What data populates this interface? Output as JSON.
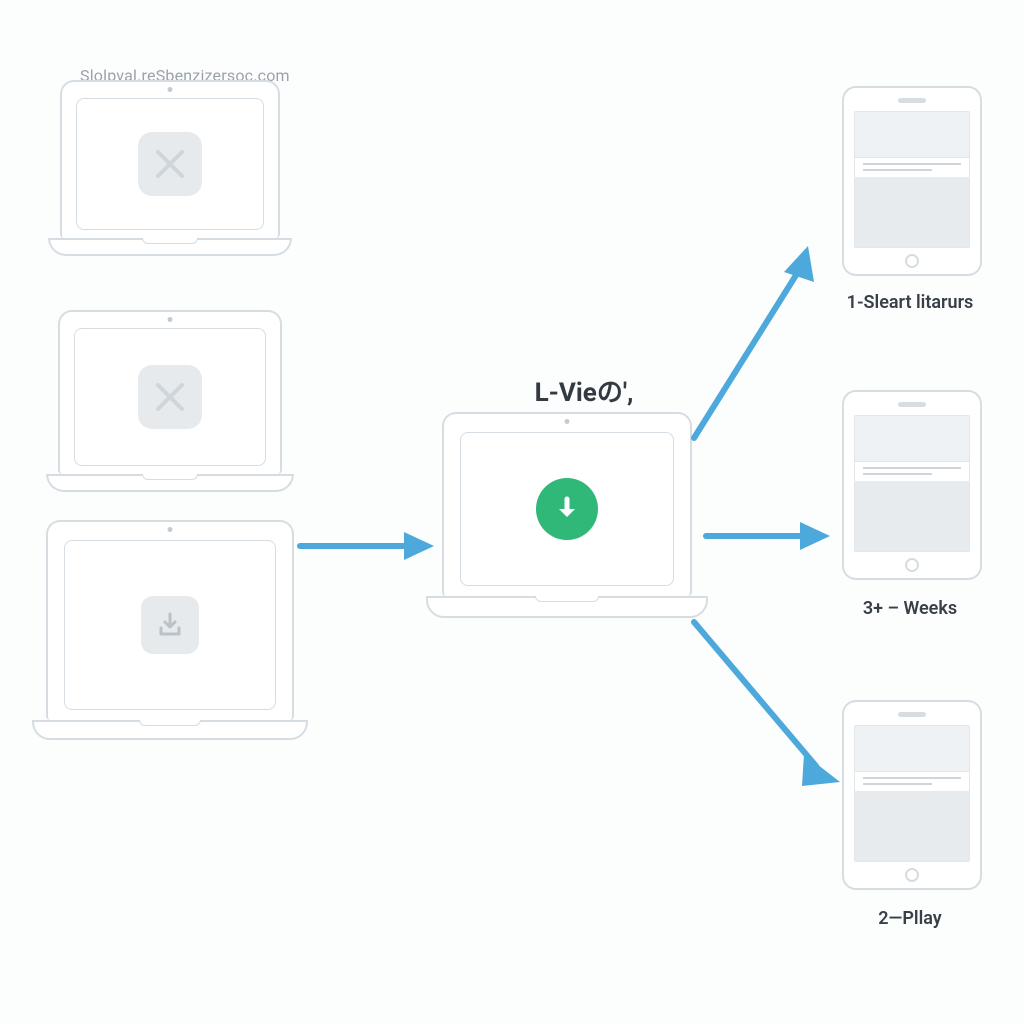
{
  "watermark": "Slolpval.reSbenzizersoc.com",
  "left_devices": {
    "device_1": {
      "icon": "x-icon"
    },
    "device_2": {
      "icon": "x-icon"
    },
    "device_3": {
      "icon": "download-tray-icon"
    }
  },
  "center": {
    "title": "L-Vieの',",
    "icon": "download-circle-icon"
  },
  "right_devices": [
    {
      "label": "1-Sleart litarurs"
    },
    {
      "label": "3+ – Weeks"
    },
    {
      "label": "2—Pllay"
    }
  ],
  "colors": {
    "outline": "#d6dde2",
    "arrow": "#4da8db",
    "accent_green": "#2fb877",
    "text": "#383f47"
  }
}
